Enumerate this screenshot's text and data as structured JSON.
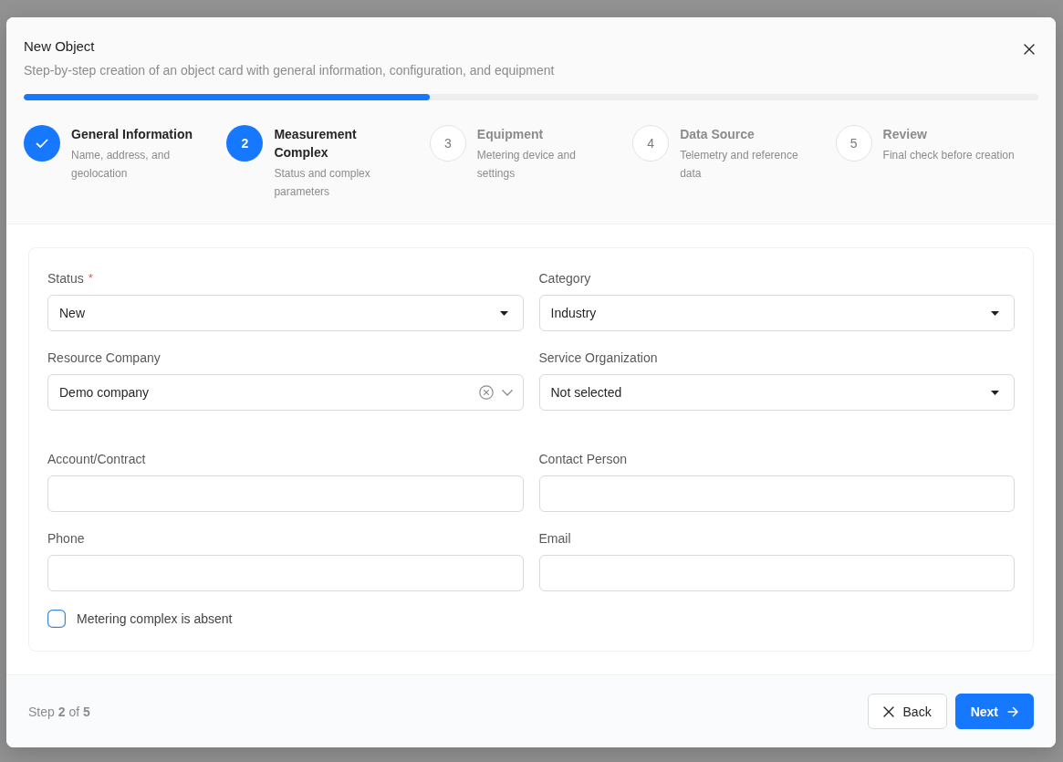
{
  "dialog": {
    "title": "New Object",
    "subtitle": "Step-by-step creation of an object card with general information, configuration, and equipment",
    "progress": {
      "level": 0.4
    }
  },
  "steps": [
    {
      "title": "General Information",
      "description": "Name, address, and geolocation",
      "completed": true,
      "selected": false
    },
    {
      "number": "2",
      "title": "Measurement Complex",
      "description": "Status and complex parameters",
      "completed": false,
      "selected": true
    },
    {
      "number": "3",
      "title": "Equipment",
      "description": "Metering device and settings",
      "completed": false,
      "selected": false
    },
    {
      "number": "4",
      "title": "Data Source",
      "description": "Telemetry and reference data",
      "completed": false,
      "selected": false
    },
    {
      "number": "5",
      "title": "Review",
      "description": "Final check before creation",
      "completed": false,
      "selected": false
    }
  ],
  "form": {
    "field_groups": [
      {
        "fields": [
          {
            "kind": "select",
            "label": "Status",
            "required_mark": "*",
            "value": "New"
          },
          {
            "kind": "select",
            "label": "Category",
            "value": "Industry"
          },
          {
            "kind": "combobox",
            "label": "Resource Company",
            "value": "Demo company"
          },
          {
            "kind": "select",
            "label": "Service Organization",
            "value": "Not selected"
          }
        ]
      },
      {
        "fields": [
          {
            "kind": "text",
            "label": "Account/Contract"
          },
          {
            "kind": "text",
            "label": "Contact Person"
          },
          {
            "kind": "text",
            "label": "Phone"
          },
          {
            "kind": "text",
            "label": "Email"
          }
        ]
      }
    ],
    "checkbox": {
      "label": "Metering complex is absent",
      "checked": false
    }
  },
  "footer": {
    "step_counter": "Step **2** of **5**",
    "buttons": [
      {
        "kind": "back",
        "label": "Back"
      },
      {
        "kind": "next",
        "label": "Next"
      }
    ]
  }
}
